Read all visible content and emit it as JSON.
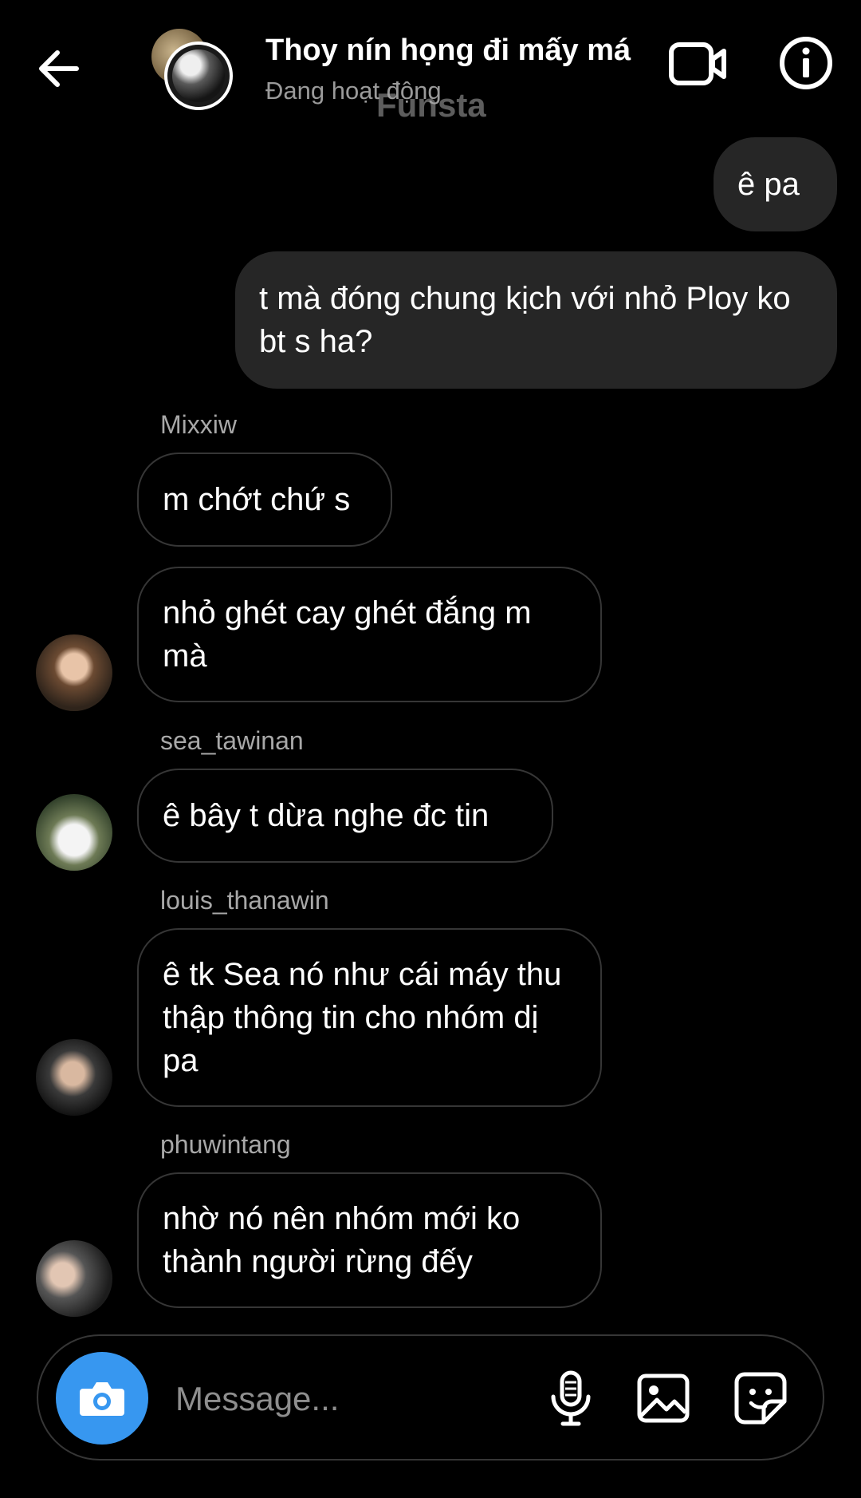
{
  "header": {
    "title": "Thoy nín họng đi mấy má",
    "status": "Đang hoạt động",
    "watermark": "Funsta",
    "icons": {
      "back": "arrow-left-icon",
      "video": "video-camera-icon",
      "info": "info-icon"
    }
  },
  "messages": [
    {
      "type": "sent",
      "text": "ê pa"
    },
    {
      "type": "sent",
      "text": "t mà đóng chung kịch với nhỏ Ploy ko bt s ha?"
    },
    {
      "type": "received",
      "sender": "Mixxiw",
      "text": "m chớt chứ s"
    },
    {
      "type": "received",
      "text": "nhỏ ghét cay ghét đắng m mà"
    },
    {
      "type": "received",
      "sender": "sea_tawinan",
      "text": "ê bây t dừa nghe đc tin"
    },
    {
      "type": "received",
      "sender": "louis_thanawin",
      "text": "ê tk Sea nó như cái máy thu thập thông tin cho nhóm dị pa"
    },
    {
      "type": "received",
      "sender": "phuwintang",
      "text": "nhờ nó nên nhóm mới ko thành người rừng đếy"
    }
  ],
  "composer": {
    "placeholder": "Message...",
    "icons": [
      "camera-icon",
      "microphone-icon",
      "gallery-icon",
      "sticker-icon"
    ]
  },
  "colors": {
    "background": "#000000",
    "sent_bubble": "#262626",
    "received_border": "#363636",
    "camera_button": "#3797f0",
    "secondary_text": "#a8a8a8"
  }
}
